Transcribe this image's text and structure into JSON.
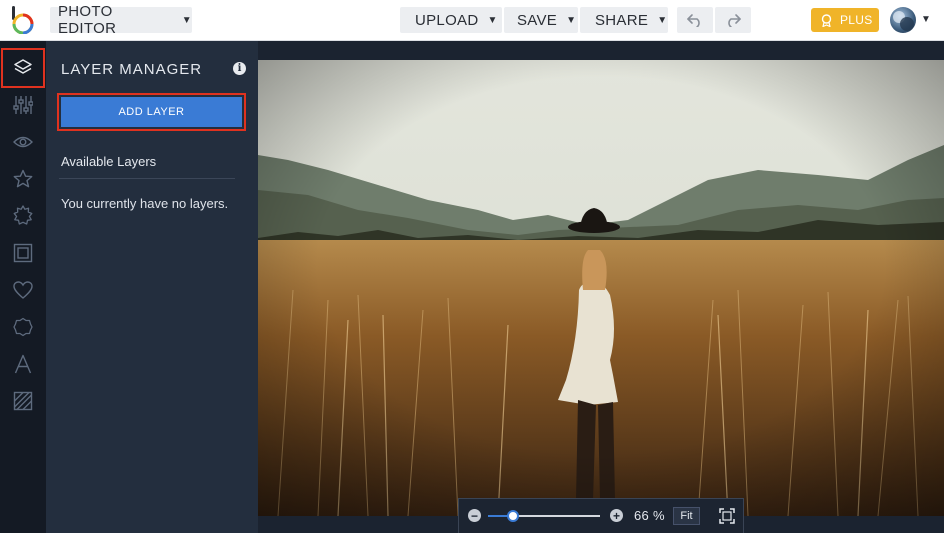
{
  "app": {
    "logo_icon": "befunky-logo-icon",
    "editor_label": "PHOTO EDITOR"
  },
  "toolbar": {
    "upload_label": "UPLOAD",
    "save_label": "SAVE",
    "share_label": "SHARE",
    "undo_icon": "undo-icon",
    "redo_icon": "redo-icon",
    "plus_label": "PLUS",
    "accent_color": "#f0b429"
  },
  "rail": {
    "tools": [
      {
        "name": "layers-icon",
        "active": true
      },
      {
        "name": "adjust-sliders-icon"
      },
      {
        "name": "eye-icon"
      },
      {
        "name": "star-icon"
      },
      {
        "name": "artsy-gear-icon"
      },
      {
        "name": "frame-icon"
      },
      {
        "name": "heart-icon"
      },
      {
        "name": "texture-badge-icon"
      },
      {
        "name": "text-icon"
      },
      {
        "name": "pattern-icon"
      }
    ]
  },
  "panel": {
    "title": "LAYER MANAGER",
    "add_layer_label": "ADD LAYER",
    "available_heading": "Available Layers",
    "empty_message": "You currently have no layers."
  },
  "zoom": {
    "percent_label": "66 %",
    "level": 0.66,
    "fit_label": "Fit",
    "fullscreen_icon": "fullscreen-icon"
  },
  "colors": {
    "highlight": "#e0321f",
    "primary_button": "#3a7bd5",
    "panel_bg": "#232e3e"
  }
}
